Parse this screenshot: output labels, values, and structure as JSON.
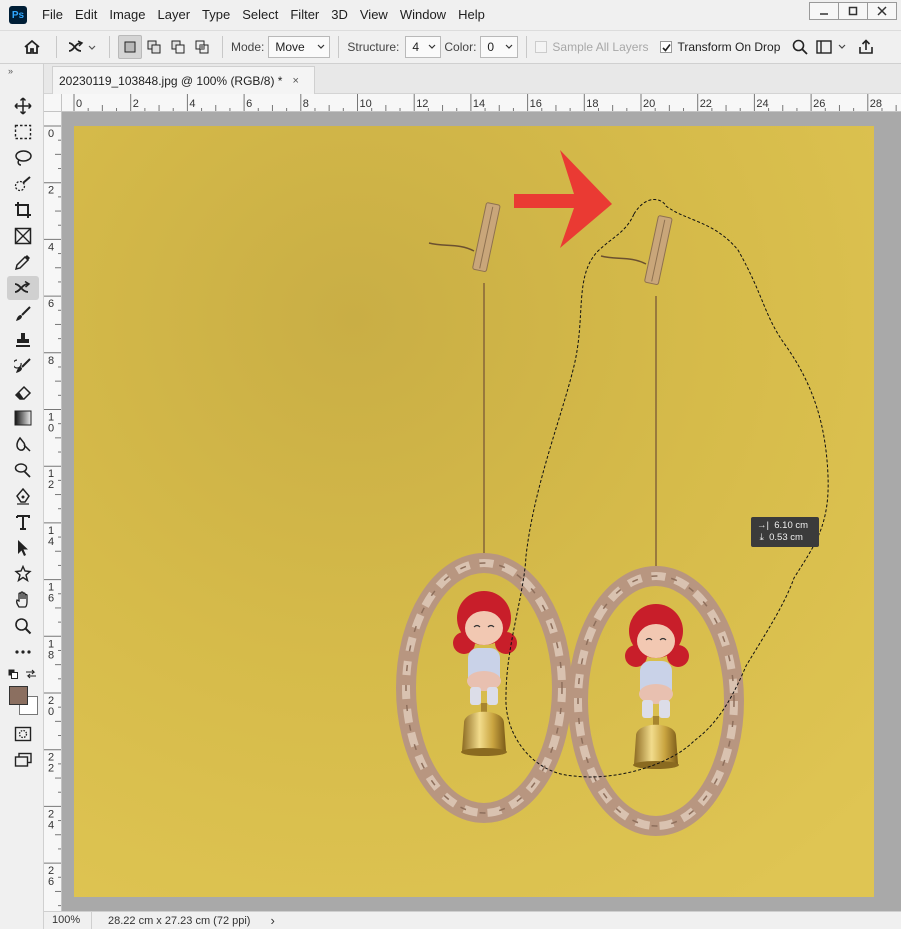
{
  "app": {
    "logo_text": "Ps"
  },
  "menu": [
    "File",
    "Edit",
    "Image",
    "Layer",
    "Type",
    "Select",
    "Filter",
    "3D",
    "View",
    "Window",
    "Help"
  ],
  "options": {
    "mode_label": "Mode:",
    "mode_value": "Move",
    "structure_label": "Structure:",
    "structure_value": "4",
    "color_label": "Color:",
    "color_value": "0",
    "sample_all_layers": "Sample All Layers",
    "sample_all_layers_checked": false,
    "transform_on_drop": "Transform On Drop",
    "transform_on_drop_checked": true
  },
  "document": {
    "tab_title": "20230119_103848.jpg @ 100% (RGB/8) *",
    "close_glyph": "×"
  },
  "ruler": {
    "top_labels": [
      "0",
      "2",
      "4",
      "6",
      "8",
      "10",
      "12",
      "14",
      "16",
      "18",
      "20",
      "22",
      "24",
      "26",
      "28"
    ],
    "left_labels": [
      "0",
      "2",
      "4",
      "6",
      "8",
      "10",
      "12",
      "14",
      "16",
      "18",
      "20",
      "22",
      "24",
      "26"
    ]
  },
  "hud": {
    "dx": "6.10 cm",
    "dy": "0.53 cm"
  },
  "status": {
    "zoom": "100%",
    "doc_size": "28.22 cm x 27.23 cm (72 ppi)",
    "arrow": "›"
  },
  "colors": {
    "foreground": "#8b6f60",
    "background": "#ffffff",
    "canvas_yellow": "#d8bd4a",
    "arrow_red": "#ea3a33"
  },
  "tools": [
    "move-icon",
    "marquee-icon",
    "lasso-icon",
    "quick-select-icon",
    "crop-icon",
    "frame-icon",
    "eyedropper-icon",
    "content-aware-move-icon",
    "brush-icon",
    "stamp-icon",
    "history-brush-icon",
    "eraser-icon",
    "gradient-icon",
    "blur-icon",
    "dodge-icon",
    "pen-icon",
    "type-icon",
    "path-select-icon",
    "shape-icon",
    "hand-icon",
    "zoom-icon",
    "more-tools-icon"
  ]
}
